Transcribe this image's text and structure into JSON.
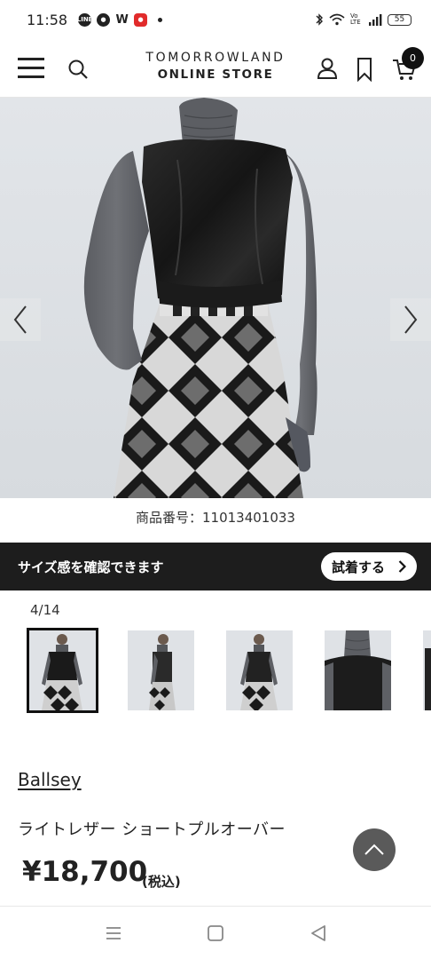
{
  "status_bar": {
    "time": "11:58",
    "app_icons": [
      "line-icon",
      "messenger-icon",
      "w-icon",
      "app-red-icon"
    ],
    "app_w_letter": "W",
    "signal_text": "Vo LTE",
    "battery": "55"
  },
  "header": {
    "logo_line1": "TOMORROWLAND",
    "logo_line2": "ONLINE STORE",
    "cart_count": "0"
  },
  "product": {
    "number": "商品番号：11013401033",
    "brand": "Ballsey",
    "name": "ライトレザー ショートプルオーバー",
    "price": "¥18,700",
    "tax_note": "(税込)"
  },
  "size_bar": {
    "text": "サイズ感を確認できます",
    "button_label": "試着する"
  },
  "gallery": {
    "counter": "4/14",
    "thumbnails": [
      "front",
      "side",
      "back",
      "collar"
    ]
  },
  "colors": {
    "dark": "#1d1d1d",
    "accent_black": "#111111",
    "scroll_button": "#5a5a5a"
  }
}
